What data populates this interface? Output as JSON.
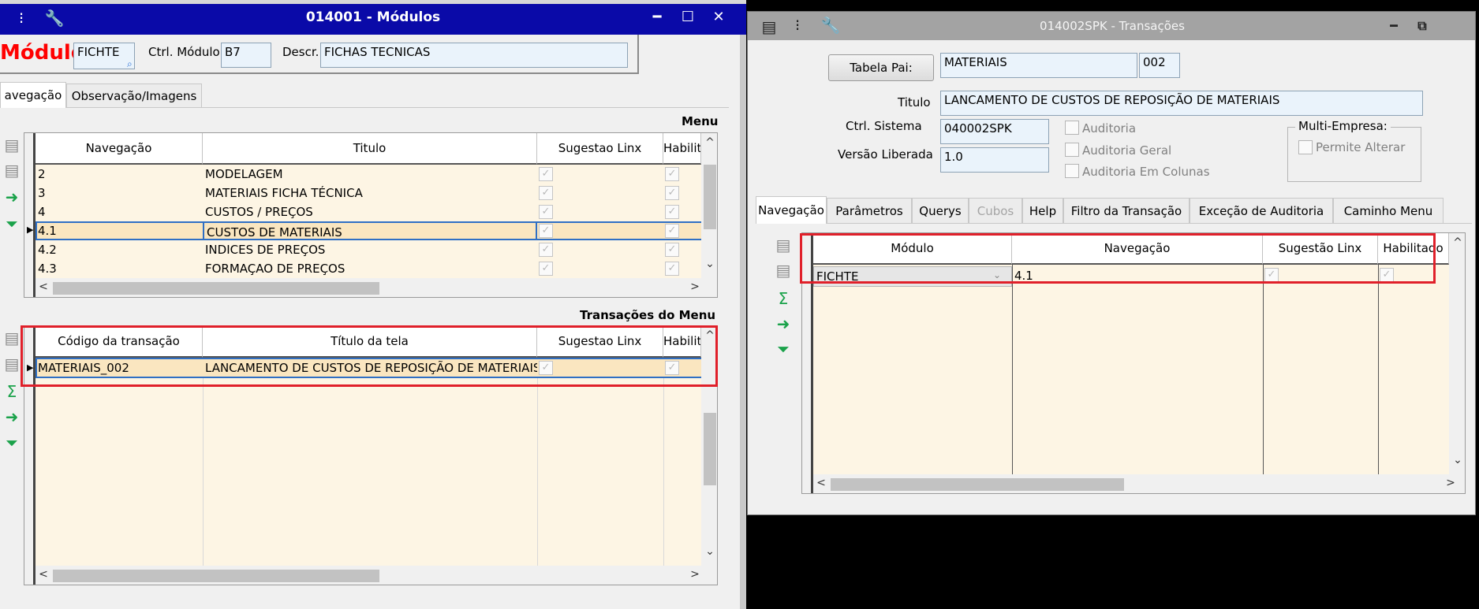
{
  "left_window": {
    "title": "014001 - Módulos",
    "controls": {
      "minimize": "━",
      "maximize": "☐",
      "close": "✕"
    },
    "modulo_label": "Módulo",
    "modulo_value": "FICHTE",
    "ctrl_label": "Ctrl. Módulo",
    "ctrl_value": "B7",
    "descr_label": "Descr.",
    "descr_value": "FICHAS TECNICAS",
    "tabs": [
      "avegação",
      "Observação/Imagens"
    ],
    "menu_section_label": "Menu",
    "menu_grid": {
      "headers": [
        "Navegação",
        "Titulo",
        "Sugestao Linx",
        "Habilit"
      ],
      "rows": [
        {
          "nav": "2",
          "titulo": "MODELAGEM"
        },
        {
          "nav": "3",
          "titulo": "MATERIAIS FICHA TÉCNICA"
        },
        {
          "nav": "4",
          "titulo": "CUSTOS / PREÇOS"
        },
        {
          "nav": "4.1",
          "titulo": "CUSTOS DE MATERIAIS"
        },
        {
          "nav": "4.2",
          "titulo": "INDICES DE PREÇOS"
        },
        {
          "nav": "4.3",
          "titulo": "FORMAÇAO DE PREÇOS"
        }
      ]
    },
    "trans_section_label": "Transações do Menu",
    "trans_grid": {
      "headers": [
        "Código da transação",
        "Título da tela",
        "Sugestao Linx",
        "Habilit"
      ],
      "rows": [
        {
          "codigo": "MATERIAIS_002",
          "titulo": "LANCAMENTO DE CUSTOS DE REPOSIÇÃO DE MATERIAIS"
        }
      ]
    }
  },
  "right_window": {
    "title": "014002SPK - Transações",
    "tabela_pai_label": "Tabela Pai:",
    "tabela_pai_value": "MATERIAIS",
    "tabela_pai_code": "002",
    "titulo_label": "Titulo",
    "titulo_value": "LANCAMENTO DE CUSTOS DE REPOSIÇÃO DE MATERIAIS",
    "ctrl_sistema_label": "Ctrl. Sistema",
    "ctrl_sistema_value": "040002SPK",
    "versao_label": "Versão Liberada",
    "versao_value": "1.0",
    "checkboxes": [
      "Auditoria",
      "Auditoria Geral",
      "Auditoria Em Colunas"
    ],
    "multi_empresa_label": "Multi-Empresa:",
    "permite_alterar_label": "Permite Alterar",
    "tabs": [
      "Navegação",
      "Parâmetros",
      "Querys",
      "Cubos",
      "Help",
      "Filtro da Transação",
      "Exceção de Auditoria",
      "Caminho Menu"
    ],
    "grid": {
      "headers": [
        "Módulo",
        "Navegação",
        "Sugestão Linx",
        "Habilitado"
      ],
      "rows": [
        {
          "modulo": "FICHTE",
          "nav": "4.1"
        }
      ]
    }
  },
  "colors": {
    "left_title_bg": "#0a0aa8",
    "right_title_bg": "#a3a3a3",
    "selected_row": "#fae6c0",
    "grid_body": "#fdf5e4",
    "highlight": "#e0202a",
    "modulo_label": "#ff0000"
  }
}
